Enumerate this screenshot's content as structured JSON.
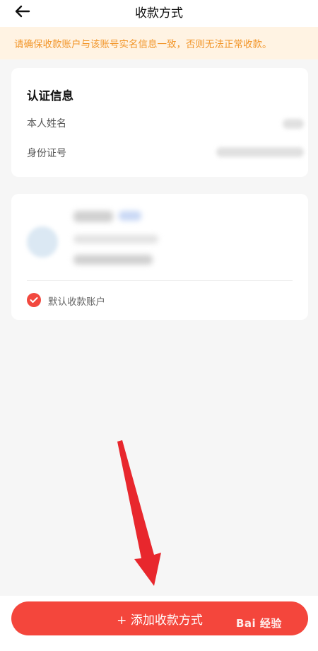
{
  "header": {
    "title": "收款方式",
    "back_icon": "arrow-left-icon"
  },
  "notice": {
    "text": "请确保收款账户与该账号实名信息一致，否则无法正常收款。",
    "color": "#f2962a",
    "background": "#fff3e3"
  },
  "certification": {
    "title": "认证信息",
    "rows": [
      {
        "label": "本人姓名"
      },
      {
        "label": "身份证号"
      }
    ]
  },
  "account": {
    "default_label": "默认收款账户",
    "check_icon": "checkmark-icon"
  },
  "footer": {
    "add_button_label": "+ 添加收款方式",
    "button_color": "#f4463c"
  },
  "annotation": {
    "arrow_icon": "red-arrow-pointer-icon"
  },
  "watermark": {
    "text": "Bai 经验"
  }
}
